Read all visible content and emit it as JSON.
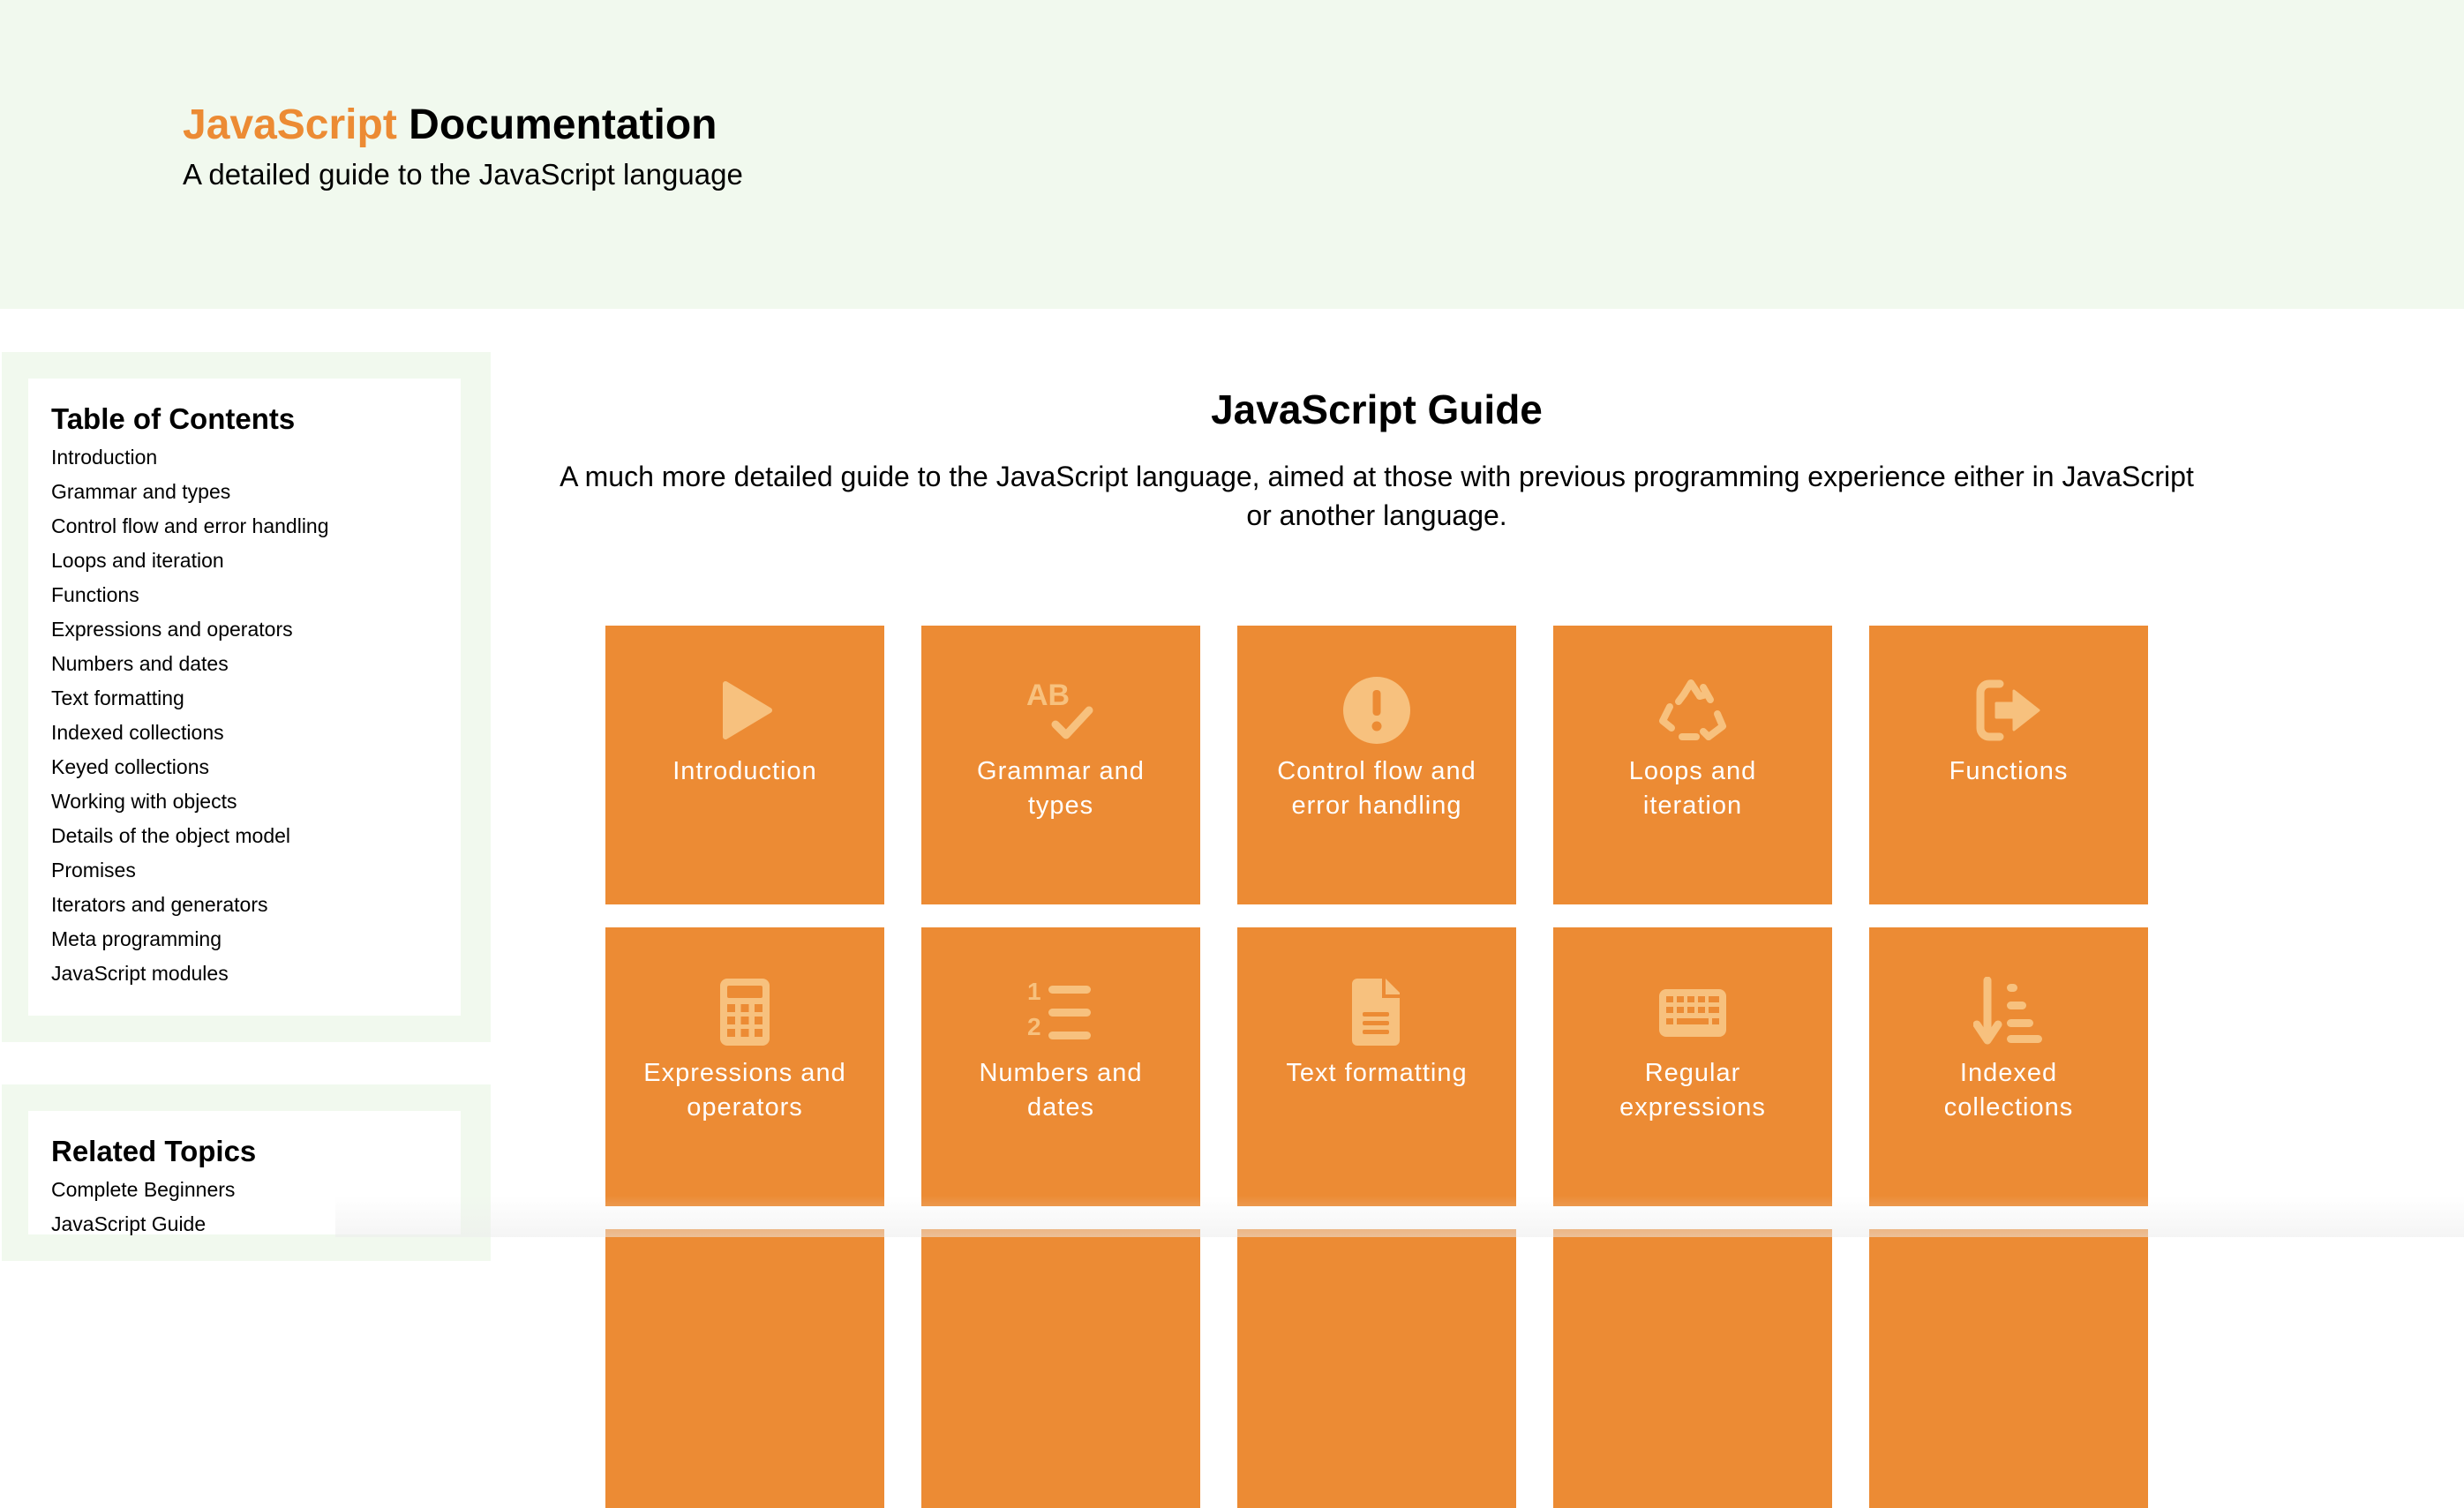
{
  "header": {
    "title_accent": "JavaScript",
    "title_rest": "Documentation",
    "tagline": "A detailed guide to the JavaScript language"
  },
  "sidebar": {
    "toc": {
      "heading": "Table of Contents",
      "items": [
        "Introduction",
        "Grammar and types",
        "Control flow and error handling",
        "Loops and iteration",
        "Functions",
        "Expressions and operators",
        "Numbers and dates",
        "Text formatting",
        "Indexed collections",
        "Keyed collections",
        "Working with objects",
        "Details of the object model",
        "Promises",
        "Iterators and generators",
        "Meta programming",
        "JavaScript modules"
      ]
    },
    "related": {
      "heading": "Related Topics",
      "items": [
        "Complete Beginners",
        "JavaScript Guide"
      ]
    }
  },
  "main": {
    "title": "JavaScript Guide",
    "intro": "A much more detailed guide to the JavaScript language, aimed at those with previous programming experience either in JavaScript or another language.",
    "tiles": [
      {
        "label": "Introduction",
        "icon": "play-icon"
      },
      {
        "label": "Grammar and types",
        "icon": "spell-check-icon"
      },
      {
        "label": "Control flow and error handling",
        "icon": "exclamation-circle-icon"
      },
      {
        "label": "Loops and iteration",
        "icon": "recycle-icon"
      },
      {
        "label": "Functions",
        "icon": "sign-out-icon"
      },
      {
        "label": "Expressions and operators",
        "icon": "calculator-icon"
      },
      {
        "label": "Numbers and dates",
        "icon": "list-ol-icon"
      },
      {
        "label": "Text formatting",
        "icon": "file-text-icon"
      },
      {
        "label": "Regular expressions",
        "icon": "keyboard-icon"
      },
      {
        "label": "Indexed collections",
        "icon": "sort-amount-down-icon"
      }
    ]
  },
  "colors": {
    "accent": "#ec8b34",
    "icon_tint": "#f7c17e",
    "panel_bg": "#f1f9ee"
  }
}
